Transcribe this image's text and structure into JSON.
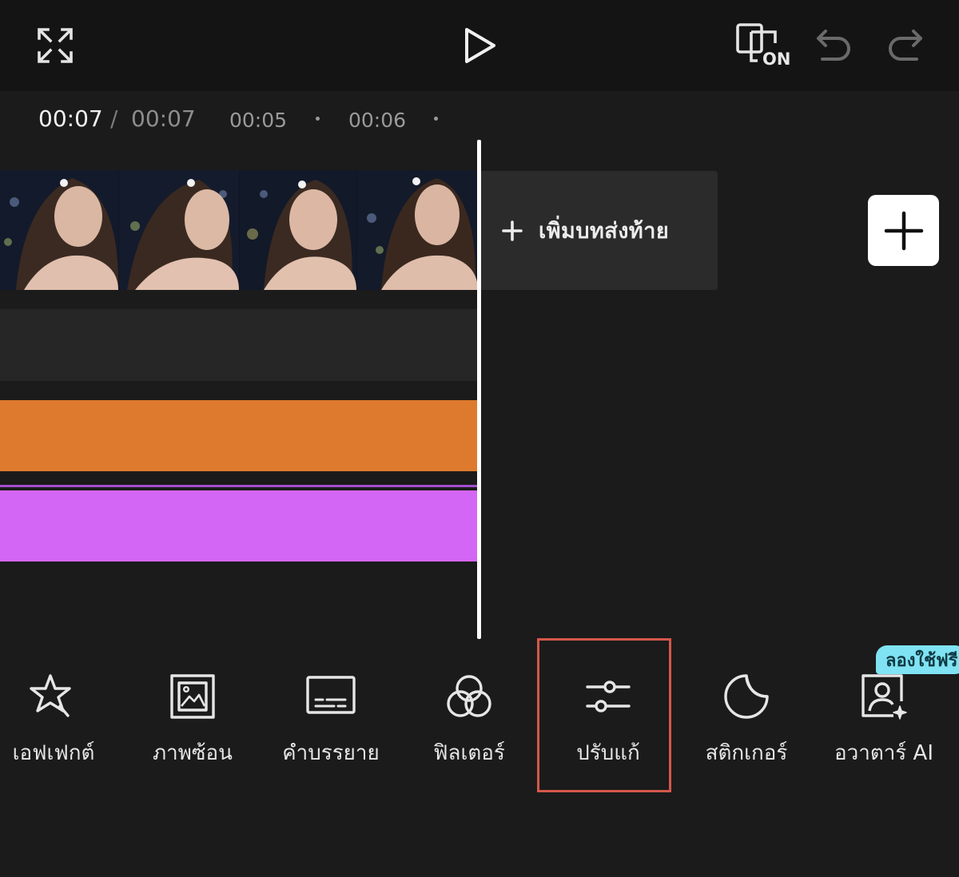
{
  "header": {
    "fullscreen_icon": "fullscreen-icon",
    "play_icon": "play-icon",
    "preview_toggle_label": "ON",
    "undo_icon": "undo-icon",
    "redo_icon": "redo-icon"
  },
  "timecode": {
    "current": "00:07",
    "separator": "/",
    "total": "00:07",
    "ruler_ticks": [
      "00:05",
      "00:06"
    ]
  },
  "timeline": {
    "add_ending_label": "เพิ่มบทส่งท้าย",
    "add_clip_icon": "plus-icon",
    "track_colors": {
      "audio": "#dd7a2e",
      "text": "#d466f5"
    }
  },
  "toolbar": {
    "items": [
      {
        "label": "เอฟเฟกต์",
        "icon": "sparkle-star-icon"
      },
      {
        "label": "ภาพซ้อน",
        "icon": "overlay-image-icon"
      },
      {
        "label": "คำบรรยาย",
        "icon": "captions-icon"
      },
      {
        "label": "ฟิลเตอร์",
        "icon": "filter-icon"
      },
      {
        "label": "ปรับแก้",
        "icon": "adjust-sliders-icon",
        "highlighted": true
      },
      {
        "label": "สติกเกอร์",
        "icon": "sticker-icon"
      },
      {
        "label": "อวาตาร์ AI",
        "icon": "ai-avatar-icon",
        "badge": "ลองใช้ฟรี"
      }
    ]
  }
}
